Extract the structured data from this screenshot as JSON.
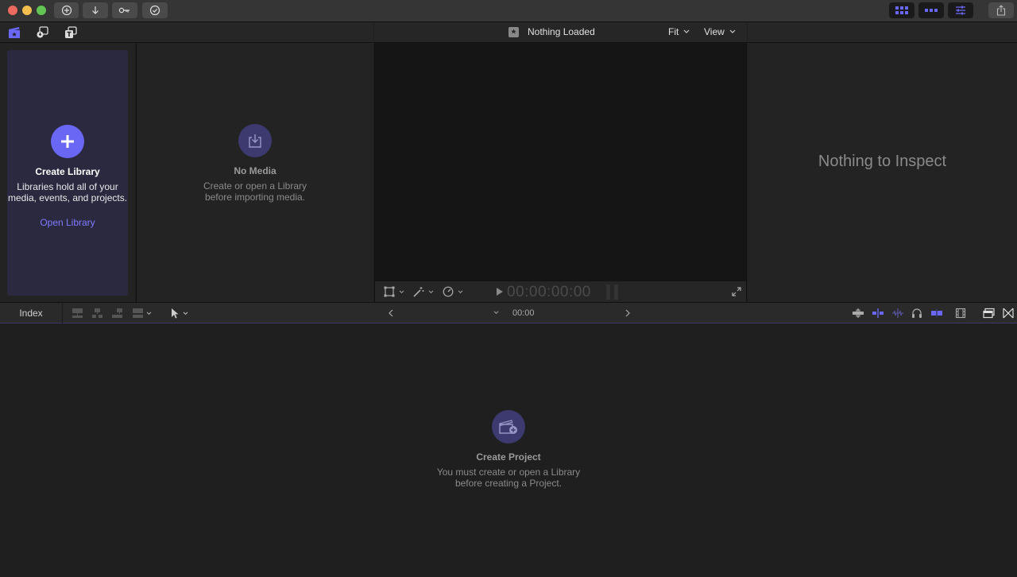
{
  "colors": {
    "accent": "#6b67f5",
    "library_card": "#2b2940",
    "close": "#ed6a5e",
    "minimize": "#f5bf4f",
    "zoom": "#62c554"
  },
  "titlebar": {
    "left_buttons": [
      "import-icon",
      "download-icon",
      "key-icon",
      "checkmark-icon"
    ],
    "right_buttons": [
      "browser-toggle-icon",
      "timeline-toggle-icon",
      "inspector-toggle-icon",
      "share-icon"
    ]
  },
  "browser_bar": {
    "icons": [
      "libraries-icon",
      "photos-audio-icon",
      "titles-generators-icon"
    ]
  },
  "libraries": {
    "title": "Create Library",
    "description_line1": "Libraries hold all of your",
    "description_line2": "media, events, and projects.",
    "link": "Open Library"
  },
  "media": {
    "title": "No Media",
    "description_line1": "Create or open a Library",
    "description_line2": "before importing media."
  },
  "viewer": {
    "title": "Nothing Loaded",
    "fit": "Fit",
    "view": "View",
    "timecode": "00:00:00:00"
  },
  "inspector": {
    "message": "Nothing to Inspect"
  },
  "timeline_bar": {
    "index": "Index",
    "timecode": "00:00"
  },
  "timeline": {
    "title": "Create Project",
    "description_line1": "You must create or open a Library",
    "description_line2": "before creating a Project."
  }
}
